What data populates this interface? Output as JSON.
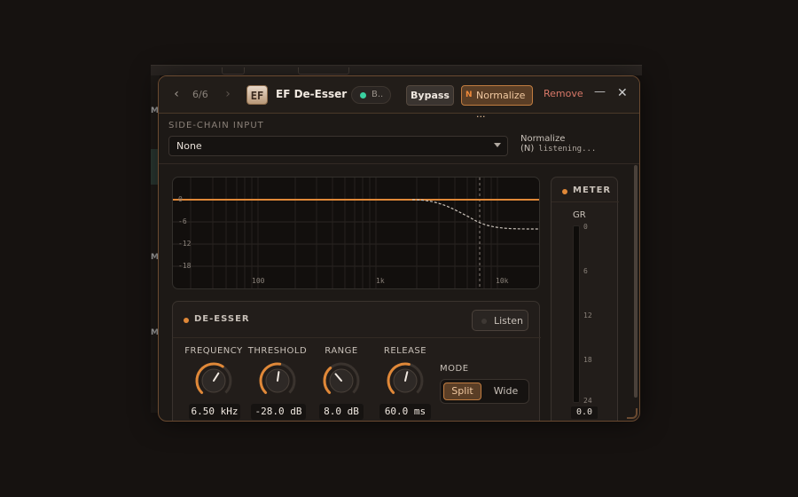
{
  "titlebar": {
    "nav_count": "6/6",
    "logo": "EF",
    "title": "EF De-Esser",
    "status_pill_label": "B..",
    "bypass_label": "Bypass",
    "normalize_badge": "N",
    "normalize_label": "Normalize ...",
    "remove_label": "Remove",
    "minimize_glyph": "—",
    "close_glyph": "✕",
    "prev_glyph": "‹",
    "next_glyph": "›"
  },
  "sidechain": {
    "label": "SIDE-CHAIN INPUT",
    "selected": "None",
    "status_label": "Normalize (N)",
    "status_value": "listening..."
  },
  "graph": {
    "y_ticks": [
      "0",
      "-6",
      "-12",
      "-18"
    ],
    "x_ticks": [
      "100",
      "1k",
      "10k"
    ]
  },
  "deesser": {
    "title": "DE-ESSER",
    "listen_label": "Listen",
    "knobs": [
      {
        "label": "FREQUENCY",
        "value": "6.50 kHz",
        "level": 0.62
      },
      {
        "label": "THRESHOLD",
        "value": "-28.0 dB",
        "level": 0.53
      },
      {
        "label": "RANGE",
        "value": "8.0 dB",
        "level": 0.35
      },
      {
        "label": "RELEASE",
        "value": "60.0 ms",
        "level": 0.55
      }
    ],
    "mode_label": "MODE",
    "mode_options": [
      "Split",
      "Wide"
    ],
    "mode_selected": "Split"
  },
  "meter": {
    "title": "METER",
    "gr_label": "GR",
    "ticks": [
      "0",
      "6",
      "12",
      "18",
      "24"
    ],
    "value": "0.0"
  },
  "colors": {
    "accent": "#e08838",
    "background": "#161210",
    "panel": "#221d1a",
    "status_dot": "#3ad0a0",
    "remove": "#d87868"
  },
  "host": {
    "side_letter": "M"
  }
}
